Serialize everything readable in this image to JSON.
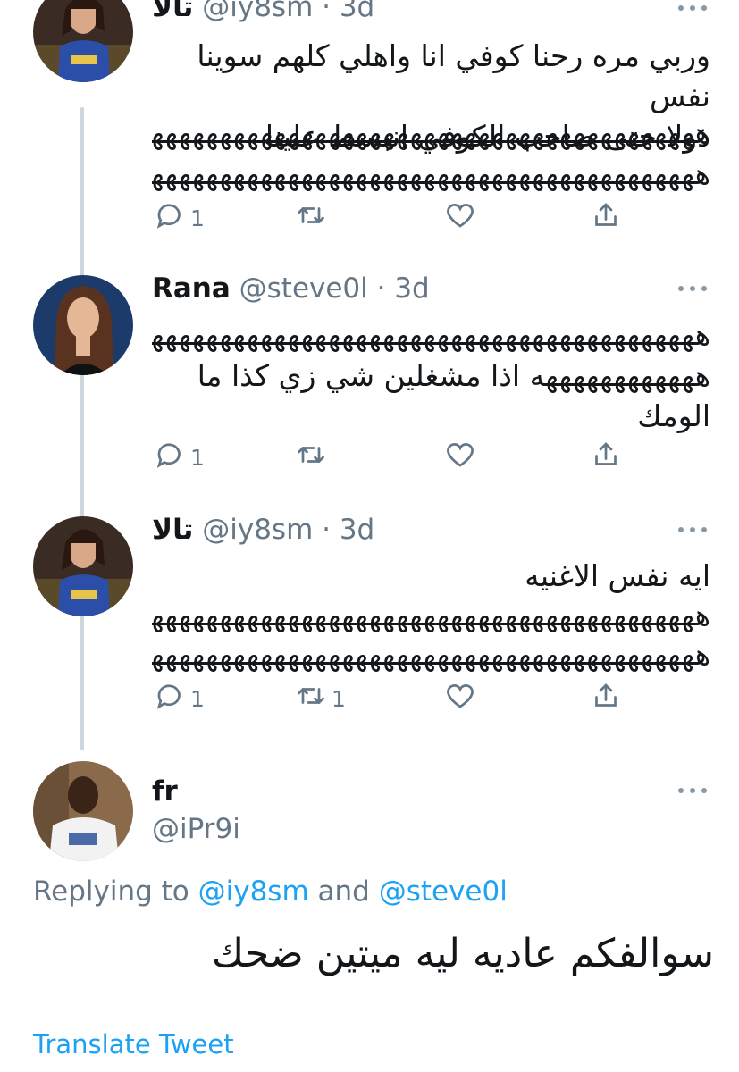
{
  "tweets": [
    {
      "name": "تالا",
      "handle": "@iy8sm · 3d",
      "text_lines": [
        "وربي مره رحنا كوفي انا واهلي كلهم سوينا نفس",
        "ذولا حتى صاحب الكوفي انبسط علينا"
      ],
      "laugh_lines": [
        "هههههههههههههههههههههههههههههههههههههههههههه",
        "هههههههههههههههههههههههههههههههههههههههههههه"
      ],
      "replies": "1",
      "retweets": "",
      "avatar": "woman-in-jersey-avatar"
    },
    {
      "name": "Rana",
      "handle": "@steve0l · 3d",
      "laugh_lines": [
        "هههههههههههههههههههههههههههههههههههههههههههه"
      ],
      "text_lines": [
        "ههههههههههههه اذا مشغلين شي زي كذا ما",
        "الومك"
      ],
      "replies": "1",
      "retweets": "",
      "avatar": "woman-portrait-avatar"
    },
    {
      "name": "تالا",
      "handle": "@iy8sm · 3d",
      "text_lines": [
        "ايه نفس الاغنيه"
      ],
      "laugh_lines": [
        "هههههههههههههههههههههههههههههههههههههههههههه",
        "هههههههههههههههههههههههههههههههههههههههههههه"
      ],
      "replies": "1",
      "retweets": "1",
      "avatar": "woman-in-jersey-avatar"
    }
  ],
  "main_tweet": {
    "name": "fr",
    "handle": "@iPr9i",
    "replying_prefix": "Replying to ",
    "replying_user1": "@iy8sm",
    "replying_and": " and ",
    "replying_user2": "@steve0l",
    "text": "سوالفكم عاديه ليه ميتين ضحك",
    "translate_label": "Translate Tweet",
    "avatar": "man-in-white-shirt-avatar"
  },
  "icons": {
    "reply": "reply-icon",
    "retweet": "retweet-icon",
    "like": "heart-icon",
    "share": "share-icon",
    "more": "more-icon"
  },
  "colors": {
    "link": "#1da1f2",
    "secondary": "#657786",
    "thread_line": "#ccd6dd"
  }
}
